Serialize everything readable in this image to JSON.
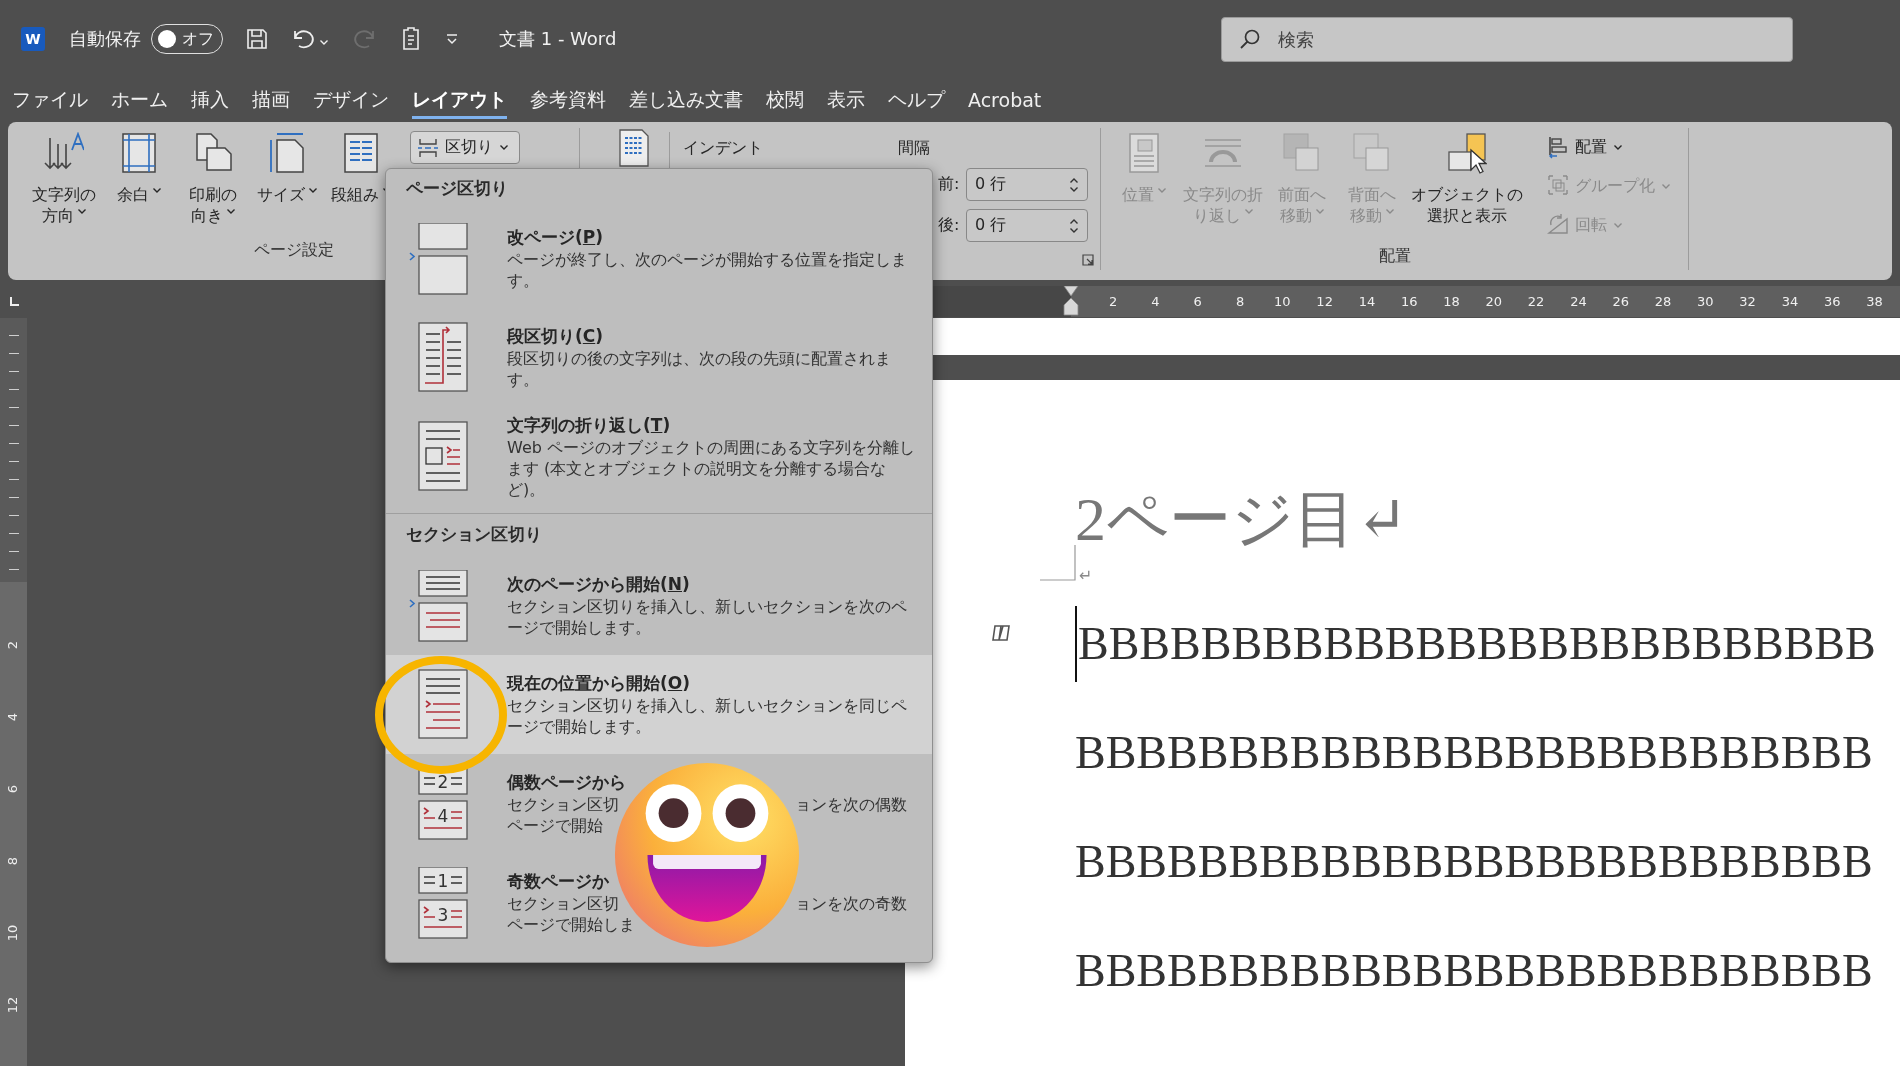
{
  "titlebar": {
    "app_logo": "W",
    "autosave_label": "自動保存",
    "autosave": {
      "on": false,
      "label": "オフ"
    },
    "redo_disabled": true,
    "doc_title": "文書 1 - Word",
    "search": {
      "placeholder": "検索"
    }
  },
  "menu_tabs": [
    {
      "label": "ファイル",
      "selected": false
    },
    {
      "label": "ホーム",
      "selected": false
    },
    {
      "label": "挿入",
      "selected": false
    },
    {
      "label": "描画",
      "selected": false
    },
    {
      "label": "デザイン",
      "selected": false
    },
    {
      "label": "レイアウト",
      "selected": true
    },
    {
      "label": "参考資料",
      "selected": false
    },
    {
      "label": "差し込み文書",
      "selected": false
    },
    {
      "label": "校閲",
      "selected": false
    },
    {
      "label": "表示",
      "selected": false
    },
    {
      "label": "ヘルプ",
      "selected": false
    },
    {
      "label": "Acrobat",
      "selected": false
    }
  ],
  "ribbon": {
    "page_setup": {
      "buttons": [
        {
          "kind": "text-direction",
          "lines": [
            "文字列の",
            "方向"
          ],
          "dropdown": true
        },
        {
          "kind": "margins",
          "lines": [
            "余白"
          ],
          "dropdown": true
        },
        {
          "kind": "orientation",
          "lines": [
            "印刷の",
            "向き"
          ],
          "dropdown": true
        },
        {
          "kind": "size",
          "lines": [
            "サイズ"
          ],
          "dropdown": true
        },
        {
          "kind": "columns",
          "lines": [
            "段組み"
          ],
          "dropdown": true
        }
      ],
      "breaks": {
        "label": "区切り",
        "expanded": true
      },
      "group_label": "ページ設定"
    },
    "paragraph": {
      "indent_label": "インデント",
      "spacing_label": "間隔",
      "spacing": [
        {
          "label": "前:",
          "value": "0 行"
        },
        {
          "label": "後:",
          "value": "0 行"
        }
      ]
    },
    "arrange": {
      "buttons": [
        {
          "kind": "position",
          "lines": [
            "位置"
          ],
          "dropdown": true,
          "disabled": true
        },
        {
          "kind": "wrap-text",
          "lines": [
            "文字列の折",
            "り返し"
          ],
          "dropdown": true,
          "disabled": true
        },
        {
          "kind": "bring-forward",
          "lines": [
            "前面へ",
            "移動"
          ],
          "dropdown": true,
          "disabled": true
        },
        {
          "kind": "send-backward",
          "lines": [
            "背面へ",
            "移動"
          ],
          "dropdown": true,
          "disabled": true
        },
        {
          "kind": "selection-pane",
          "lines": [
            "オブジェクトの",
            "選択と表示"
          ],
          "dropdown": false,
          "disabled": false
        }
      ],
      "small_buttons": [
        {
          "kind": "align",
          "label": "配置",
          "disabled": false
        },
        {
          "kind": "group",
          "label": "グループ化",
          "disabled": true
        },
        {
          "kind": "rotate",
          "label": "回転",
          "disabled": true
        }
      ],
      "group_label": "配置"
    }
  },
  "ruler": {
    "numbers": [
      "2",
      "4",
      "6",
      "8",
      "10",
      "12",
      "14",
      "16",
      "18",
      "20",
      "22",
      "24",
      "26",
      "28",
      "30",
      "32",
      "34",
      "36",
      "38"
    ]
  },
  "vertical_ruler": {
    "numbers": [
      "2",
      "4",
      "6",
      "8",
      "10",
      "12"
    ]
  },
  "document": {
    "heading": "2ページ目↵",
    "paragraph_mark": "↵",
    "lines": [
      "BBBBBBBBBBBBBBBBBBBBBBBBBB",
      "BBBBBBBBBBBBBBBBBBBBBBBBBB",
      "BBBBBBBBBBBBBBBBBBBBBBBBBB",
      "BBBBBBBBBBBBBBBBBBBBBBBBBB"
    ]
  },
  "breaks_menu": {
    "sections": [
      {
        "title": "ページ区切り",
        "items": [
          {
            "kind": "page",
            "title": "改ページ(",
            "access_key": "P",
            "title_end": ")",
            "description": "ページが終了し、次のページが開始する位置を指定します。",
            "highlighted": false
          },
          {
            "kind": "column",
            "title": "段区切り(",
            "access_key": "C",
            "title_end": ")",
            "description": "段区切りの後の文字列は、次の段の先頭に配置されます。",
            "highlighted": false
          },
          {
            "kind": "text-wrapping",
            "title": "文字列の折り返し(",
            "access_key": "T",
            "title_end": ")",
            "description": "Web ページのオブジェクトの周囲にある文字列を分離します (本文とオブジェクトの説明文を分離する場合など)。",
            "highlighted": false
          }
        ]
      },
      {
        "title": "セクション区切り",
        "items": [
          {
            "kind": "next-page",
            "title": "次のページから開始(",
            "access_key": "N",
            "title_end": ")",
            "description": "セクション区切りを挿入し、新しいセクションを次のページで開始します。",
            "highlighted": false
          },
          {
            "kind": "continuous",
            "title": "現在の位置から開始(",
            "access_key": "O",
            "title_end": ")",
            "description": "セクション区切りを挿入し、新しいセクションを同じページで開始します。",
            "highlighted": true
          },
          {
            "kind": "even-page",
            "title": "偶数ページから",
            "icon_digits": [
              "2",
              "4"
            ],
            "description_lines": [
              [
                "セクション区切",
                "ョンを次の偶数"
              ],
              [
                "ページで開始"
              ]
            ],
            "highlighted": false
          },
          {
            "kind": "odd-page",
            "title": "奇数ページか",
            "icon_digits": [
              "1",
              "3"
            ],
            "description_lines": [
              [
                "セクション区切",
                "ョンを次の奇数"
              ],
              [
                "ページで開始しま"
              ]
            ],
            "highlighted": false
          }
        ]
      }
    ]
  }
}
